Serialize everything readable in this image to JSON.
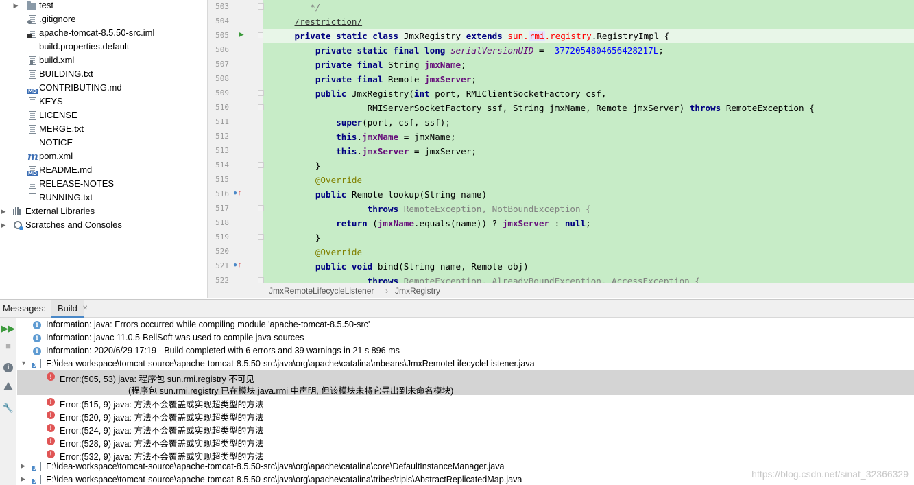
{
  "project_tree": {
    "items": [
      {
        "label": "test",
        "icon": "folder-icon"
      },
      {
        "label": ".gitignore",
        "icon": "file-icon"
      },
      {
        "label": "apache-tomcat-8.5.50-src.iml",
        "icon": "file-icon"
      },
      {
        "label": "build.properties.default",
        "icon": "file-icon"
      },
      {
        "label": "build.xml",
        "icon": "file-icon"
      },
      {
        "label": "BUILDING.txt",
        "icon": "file-icon"
      },
      {
        "label": "CONTRIBUTING.md",
        "icon": "markdown-icon"
      },
      {
        "label": "KEYS",
        "icon": "file-icon"
      },
      {
        "label": "LICENSE",
        "icon": "file-icon"
      },
      {
        "label": "MERGE.txt",
        "icon": "file-icon"
      },
      {
        "label": "NOTICE",
        "icon": "file-icon"
      },
      {
        "label": "pom.xml",
        "icon": "maven-icon"
      },
      {
        "label": "README.md",
        "icon": "markdown-icon"
      },
      {
        "label": "RELEASE-NOTES",
        "icon": "file-icon"
      },
      {
        "label": "RUNNING.txt",
        "icon": "file-icon"
      },
      {
        "label": "External Libraries",
        "icon": "library-icon"
      },
      {
        "label": "Scratches and Consoles",
        "icon": "scratch-icon"
      }
    ]
  },
  "editor": {
    "line_numbers": [
      "503",
      "504",
      "505",
      "506",
      "507",
      "508",
      "509",
      "510",
      "511",
      "512",
      "513",
      "514",
      "515",
      "516",
      "517",
      "518",
      "519",
      "520",
      "521",
      "522"
    ],
    "lines": {
      "l503": "*/",
      "l504": "/restriction/",
      "l505": {
        "kw": "private static class ",
        "name": "JmxRegistry ",
        "ext": "extends ",
        "pkg1": "sun.",
        "pkg2": "rmi",
        "pkg3": ".registry",
        "rest": ".RegistryImpl {"
      },
      "l506": {
        "kw": "private static final long ",
        "field": "serialVersionUID",
        "eq": " = ",
        "num": "-3772054804656428217L",
        "end": ";"
      },
      "l507": {
        "kw": "private final ",
        "type": "String ",
        "field": "jmxName",
        "end": ";"
      },
      "l508": {
        "kw": "private final ",
        "type": "Remote ",
        "field": "jmxServer",
        "end": ";"
      },
      "l509": {
        "kw": "public ",
        "rest1": "JmxRegistry(",
        "kw2": "int ",
        "rest2": "port, RMIClientSocketFactory csf,"
      },
      "l510": {
        "rest": "RMIServerSocketFactory ssf, String jmxName, Remote jmxServer) ",
        "kw": "throws ",
        "rest2": "RemoteException {"
      },
      "l511": {
        "kw": "super",
        "rest": "(port, csf, ssf);"
      },
      "l512": {
        "kw": "this",
        "dot": ".",
        "field": "jmxName",
        "rest": " = jmxName;"
      },
      "l513": {
        "kw": "this",
        "dot": ".",
        "field": "jmxServer",
        "rest": " = jmxServer;"
      },
      "l514": "}",
      "l515": "@Override",
      "l516": {
        "kw": "public ",
        "rest": "Remote lookup(String name)"
      },
      "l517": {
        "kw": "throws ",
        "rest": "RemoteException, NotBoundException {"
      },
      "l518": {
        "kw": "return ",
        "rest1": "(",
        "field1": "jmxName",
        "rest2": ".equals(name)) ? ",
        "field2": "jmxServer",
        "rest3": " : ",
        "kw2": "null",
        "end": ";"
      },
      "l519": "}",
      "l520": "@Override",
      "l521": {
        "kw": "public void ",
        "rest": "bind(String name, Remote obj)"
      },
      "l522": {
        "kw": "throws ",
        "rest": "RemoteException, AlreadyBoundException, AccessException {"
      }
    },
    "breadcrumb": [
      "JmxRemoteLifecycleListener",
      "JmxRegistry"
    ]
  },
  "messages": {
    "title": "Messages:",
    "tab": "Build",
    "rows": [
      {
        "type": "info",
        "text": "Information: java: Errors occurred while compiling module 'apache-tomcat-8.5.50-src'"
      },
      {
        "type": "info",
        "text": "Information: javac 11.0.5-BellSoft was used to compile java sources"
      },
      {
        "type": "info",
        "text": "Information: 2020/6/29 17:19 - Build completed with 6 errors and 39 warnings in 21 s 896 ms"
      },
      {
        "type": "file",
        "text": "E:\\idea-workspace\\tomcat-source\\apache-tomcat-8.5.50-src\\java\\org\\apache\\catalina\\mbeans\\JmxRemoteLifecycleListener.java"
      },
      {
        "type": "error",
        "text": "Error:(505, 53)  java: 程序包 sun.rmi.registry 不可见",
        "text2": "(程序包 sun.rmi.registry 已在模块 java.rmi 中声明, 但该模块未将它导出到未命名模块)"
      },
      {
        "type": "error",
        "text": "Error:(515, 9)  java: 方法不会覆盖或实现超类型的方法"
      },
      {
        "type": "error",
        "text": "Error:(520, 9)  java: 方法不会覆盖或实现超类型的方法"
      },
      {
        "type": "error",
        "text": "Error:(524, 9)  java: 方法不会覆盖或实现超类型的方法"
      },
      {
        "type": "error",
        "text": "Error:(528, 9)  java: 方法不会覆盖或实现超类型的方法"
      },
      {
        "type": "error",
        "text": "Error:(532, 9)  java: 方法不会覆盖或实现超类型的方法"
      },
      {
        "type": "file",
        "text": "E:\\idea-workspace\\tomcat-source\\apache-tomcat-8.5.50-src\\java\\org\\apache\\catalina\\core\\DefaultInstanceManager.java"
      },
      {
        "type": "file",
        "text": "E:\\idea-workspace\\tomcat-source\\apache-tomcat-8.5.50-src\\java\\org\\apache\\catalina\\tribes\\tipis\\AbstractReplicatedMap.java"
      }
    ]
  },
  "watermark": "https://blog.csdn.net/sinat_32366329",
  "colors": {
    "editor_bg": "#c7ecc7",
    "keyword": "#000080",
    "field": "#660e7a",
    "number": "#0000ff",
    "annotation": "#808000",
    "error": "#e05555",
    "info": "#5e9bd2"
  }
}
